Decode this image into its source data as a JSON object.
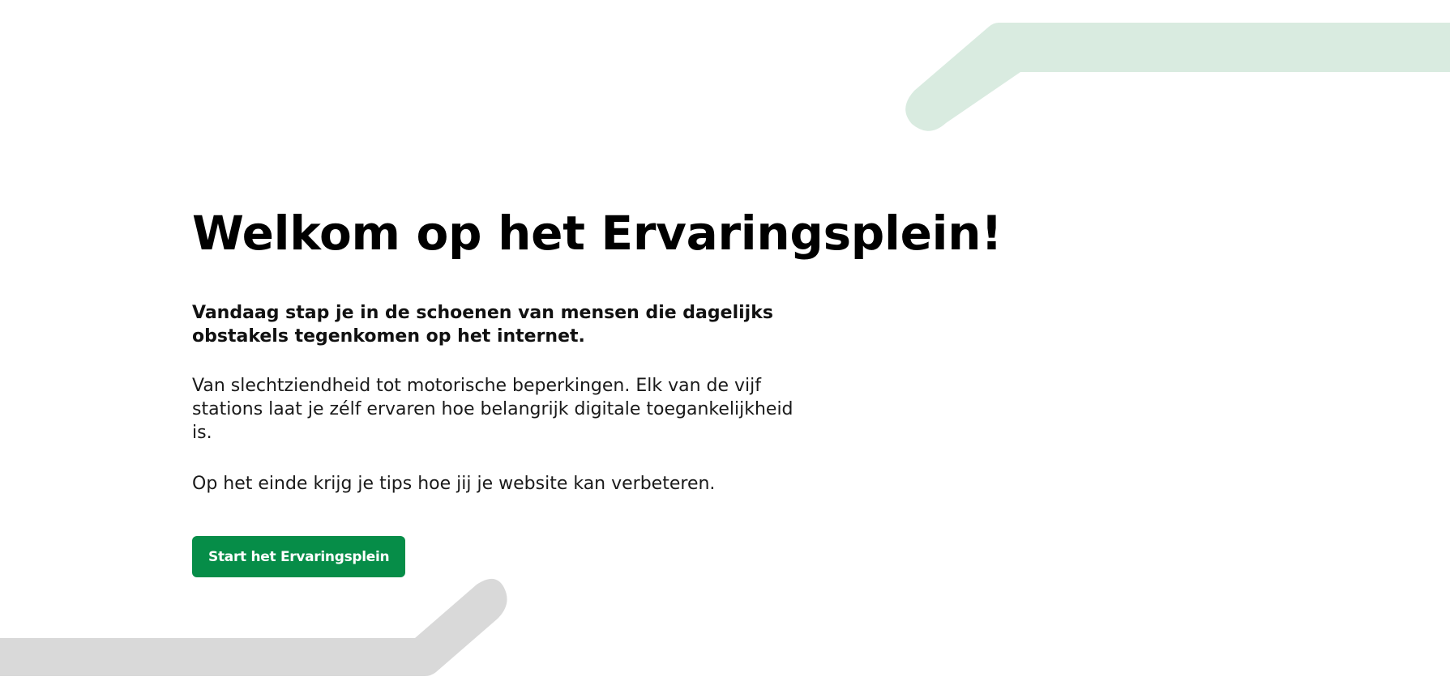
{
  "hero": {
    "title": "Welkom op het Ervaringsplein!",
    "lead": "Vandaag stap je in de schoenen van mensen die dagelijks obstakels tegenkomen op het internet.",
    "body": "Van slechtziendheid tot motorische beperkingen. Elk van de vijf stations laat je zélf ervaren hoe belangrijk digitale toegankelijkheid is.",
    "tips": "Op het einde krijg je tips hoe jij je website kan verbeteren.",
    "start_button_label": "Start het Ervaringsplein"
  },
  "colors": {
    "accent": "#068d48",
    "decor_green": "#d9ebe0",
    "decor_gray": "#d9d9d9",
    "text": "#111111"
  }
}
